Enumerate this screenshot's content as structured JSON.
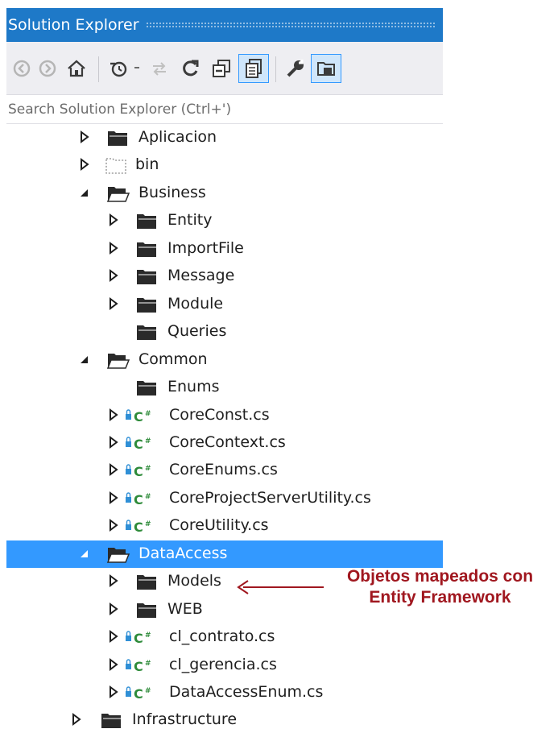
{
  "panel": {
    "title": "Solution Explorer"
  },
  "toolbar": {
    "buttons": [
      "back-icon",
      "forward-icon",
      "home-icon",
      "history-icon",
      "dropdown-icon",
      "sync-icon",
      "refresh-icon",
      "collapse-all-icon",
      "show-all-files-icon",
      "properties-icon",
      "preview-icon"
    ]
  },
  "search": {
    "placeholder": "Search Solution Explorer (Ctrl+')"
  },
  "tree": {
    "rows": [
      {
        "label": "Aplicacion",
        "type": "folder",
        "expanded": false
      },
      {
        "label": "bin",
        "type": "folder-excluded",
        "expanded": false
      },
      {
        "label": "Business",
        "type": "folder",
        "expanded": true
      },
      {
        "label": "Entity",
        "type": "folder",
        "expanded": false
      },
      {
        "label": "ImportFile",
        "type": "folder",
        "expanded": false
      },
      {
        "label": "Message",
        "type": "folder",
        "expanded": false
      },
      {
        "label": "Module",
        "type": "folder",
        "expanded": false
      },
      {
        "label": "Queries",
        "type": "folder",
        "expanded": null
      },
      {
        "label": "Common",
        "type": "folder",
        "expanded": true
      },
      {
        "label": "Enums",
        "type": "folder",
        "expanded": null
      },
      {
        "label": "CoreConst.cs",
        "type": "csharp",
        "expanded": false
      },
      {
        "label": "CoreContext.cs",
        "type": "csharp",
        "expanded": false
      },
      {
        "label": "CoreEnums.cs",
        "type": "csharp",
        "expanded": false
      },
      {
        "label": "CoreProjectServerUtility.cs",
        "type": "csharp",
        "expanded": false
      },
      {
        "label": "CoreUtility.cs",
        "type": "csharp",
        "expanded": false
      },
      {
        "label": "DataAccess",
        "type": "folder",
        "expanded": true,
        "selected": true
      },
      {
        "label": "Models",
        "type": "folder",
        "expanded": false
      },
      {
        "label": "WEB",
        "type": "folder",
        "expanded": false
      },
      {
        "label": "cl_contrato.cs",
        "type": "csharp",
        "expanded": false
      },
      {
        "label": "cl_gerencia.cs",
        "type": "csharp",
        "expanded": false
      },
      {
        "label": "DataAccessEnum.cs",
        "type": "csharp",
        "expanded": false
      },
      {
        "label": "Infrastructure",
        "type": "folder",
        "expanded": false
      }
    ],
    "csharp_badge": "C#"
  },
  "annotation": {
    "line1": "Objetos mapeados con",
    "line2": "Entity Framework",
    "color": "#a0171f"
  },
  "colors": {
    "accent": "#1e79c8",
    "selection": "#3399ff"
  }
}
